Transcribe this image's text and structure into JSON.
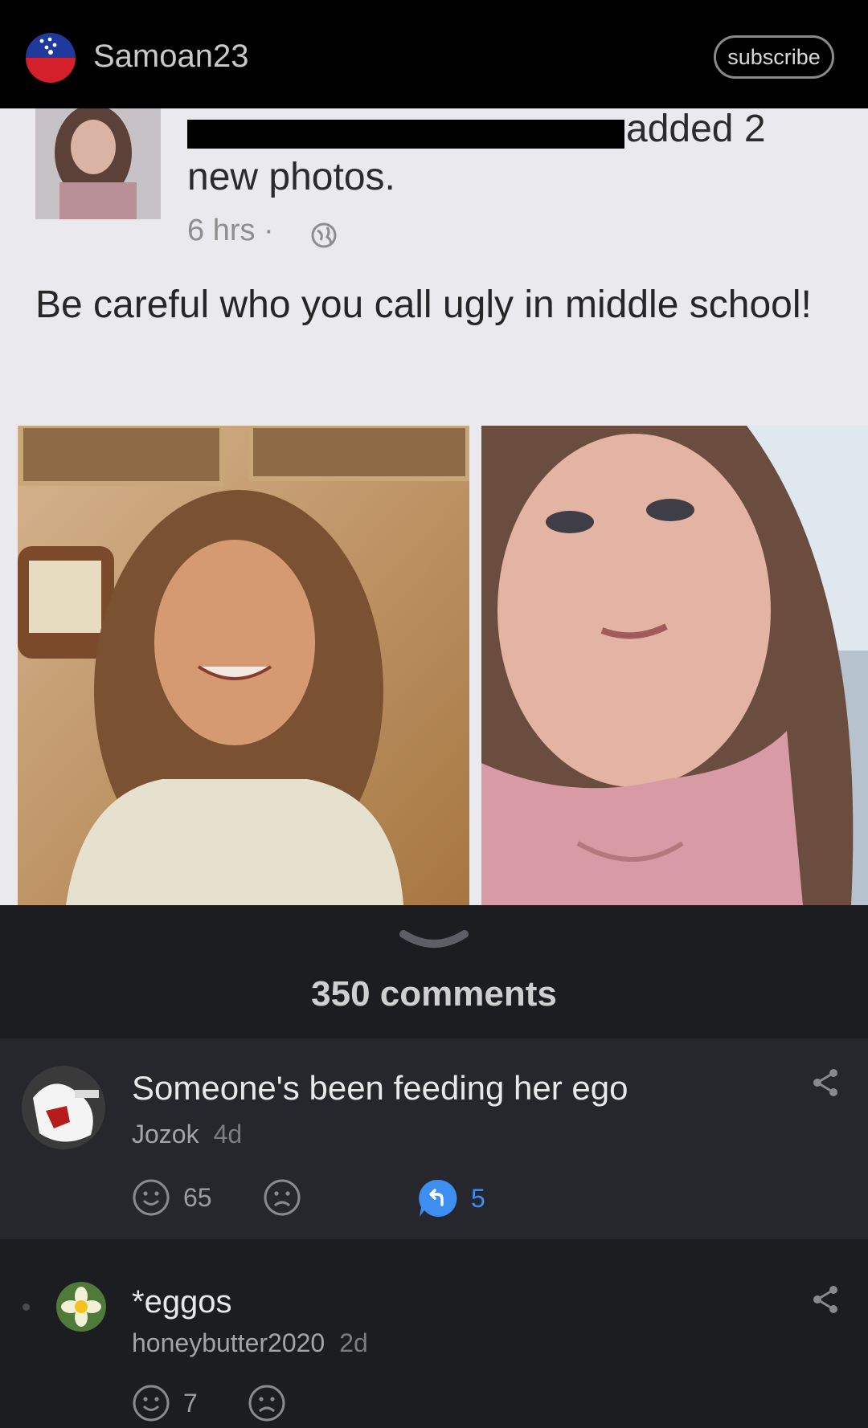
{
  "header": {
    "username": "Samoan23",
    "subscribe_label": "subscribe"
  },
  "post": {
    "added_text": "added 2",
    "new_photos_text": "new photos.",
    "time_text": "6 hrs ·",
    "caption": "Be careful who you call ugly in middle school!"
  },
  "comments_header": {
    "count_label": "350 comments"
  },
  "comments": [
    {
      "text": "Someone's been feeding her ego",
      "author": "Jozok",
      "age": "4d",
      "likes": "65",
      "replies": "5"
    },
    {
      "text": "*eggos",
      "author": "honeybutter2020",
      "age": "2d",
      "likes": "7"
    }
  ],
  "colors": {
    "accent_blue": "#3d8ef0",
    "header_bg": "#000000",
    "page_bg": "#1c1d21",
    "comment_bg": "#26272d"
  },
  "icons": [
    "samoa-flag-icon",
    "globe-icon",
    "chevron-down-icon",
    "share-icon",
    "smile-icon",
    "frown-icon",
    "reply-icon"
  ]
}
